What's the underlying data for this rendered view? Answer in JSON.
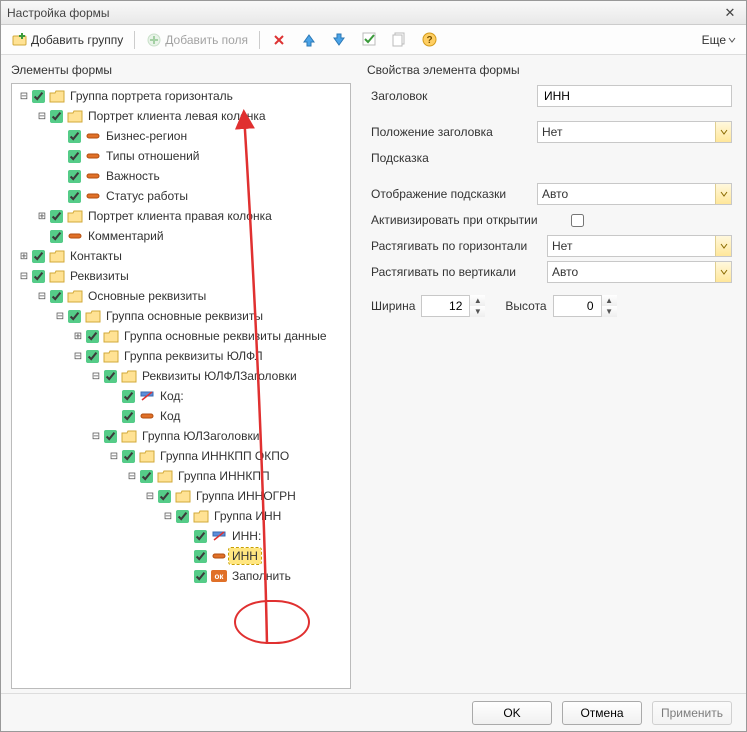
{
  "window": {
    "title": "Настройка формы"
  },
  "toolbar": {
    "add_group": "Добавить группу",
    "add_fields": "Добавить поля",
    "more": "Еще"
  },
  "left": {
    "title": "Элементы формы"
  },
  "right": {
    "title": "Свойства элемента формы"
  },
  "tree": {
    "n0": "Группа портрета горизонталь",
    "n1": "Портрет клиента левая колонка",
    "n2": "Бизнес-регион",
    "n3": "Типы отношений",
    "n4": "Важность",
    "n5": "Статус работы",
    "n6": "Портрет клиента правая колонка",
    "n7": "Комментарий",
    "n8": "Контакты",
    "n9": "Реквизиты",
    "n10": "Основные реквизиты",
    "n11": "Группа основные реквизиты",
    "n12": "Группа основные реквизиты данные",
    "n13": "Группа реквизиты ЮЛФЛ",
    "n14": "Реквизиты ЮЛФЛЗаголовки",
    "n15": "Код:",
    "n16": "Код",
    "n17": "Группа ЮЛЗаголовки",
    "n18": "Группа ИННКПП ОКПО",
    "n19": "Группа ИННКПП",
    "n20": "Группа ИННОГРН",
    "n21": "Группа ИНН",
    "n22": "ИНН:",
    "n23": "ИНН",
    "n24": "Заполнить"
  },
  "props": {
    "title_label": "Заголовок",
    "title_value": "ИНН",
    "title_pos_label": "Положение заголовка",
    "title_pos_value": "Нет",
    "hint_label": "Подсказка",
    "hint_display_label": "Отображение подсказки",
    "hint_display_value": "Авто",
    "activate_label": "Активизировать при открытии",
    "stretch_h_label": "Растягивать по горизонтали",
    "stretch_h_value": "Нет",
    "stretch_v_label": "Растягивать по вертикали",
    "stretch_v_value": "Авто",
    "width_label": "Ширина",
    "width_value": "12",
    "height_label": "Высота",
    "height_value": "0"
  },
  "footer": {
    "ok": "OK",
    "cancel": "Отмена",
    "apply": "Применить"
  }
}
